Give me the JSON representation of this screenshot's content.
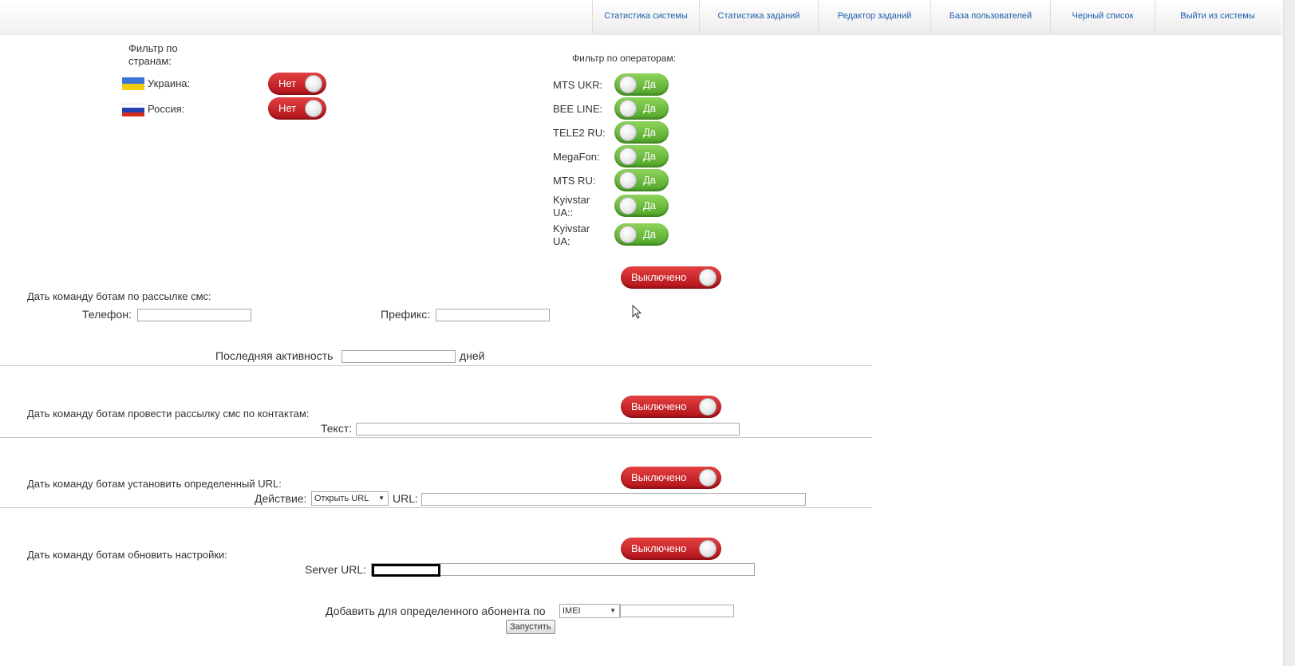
{
  "nav": [
    {
      "label": "Статистика системы"
    },
    {
      "label": "Статистика заданий"
    },
    {
      "label": "Редактор заданий"
    },
    {
      "label": "База пользователей"
    },
    {
      "label": "Черный список"
    },
    {
      "label": "Выйти из системы"
    }
  ],
  "country_filter": {
    "title_line1": "Фильтр по",
    "title_line2": "странам:",
    "items": [
      {
        "label": "Украина:",
        "toggle": "Нет",
        "flag_colors": [
          "#3a74d4",
          "#f3cc12"
        ]
      },
      {
        "label": "Россия:",
        "toggle": "Нет",
        "flag_colors": [
          "#ffffff",
          "#2240b2",
          "#d52b1e"
        ]
      }
    ]
  },
  "operator_filter": {
    "title": "Фильтр по операторам:",
    "items": [
      {
        "label": "MTS UKR:",
        "toggle": "Да"
      },
      {
        "label": "BEE LINE:",
        "toggle": "Да"
      },
      {
        "label": "TELE2 RU:",
        "toggle": "Да"
      },
      {
        "label": "MegaFon:",
        "toggle": "Да"
      },
      {
        "label": "MTS RU:",
        "toggle": "Да"
      },
      {
        "label_line1": "Kyivstar",
        "label_line2": "UA::",
        "toggle": "Да"
      },
      {
        "label_line1": "Kyivstar",
        "label_line2": "UA:",
        "toggle": "Да"
      }
    ]
  },
  "sms_send": {
    "title": "Дать команду ботам по рассылке смс:",
    "toggle": "Выключено",
    "phone_label": "Телефон:",
    "prefix_label": "Префикс:",
    "activity_label": "Последняя активность",
    "activity_unit": "дней"
  },
  "contacts_send": {
    "title": "Дать команду ботам провести рассылку смс по контактам:",
    "toggle": "Выключено",
    "text_label": "Текст:"
  },
  "url_set": {
    "title": "Дать команду ботам установить определенный URL:",
    "toggle": "Выключено",
    "action_label": "Действие:",
    "action_value": "Открыть URL",
    "url_label": "URL:"
  },
  "settings_update": {
    "title": "Дать команду ботам обновить настройки:",
    "toggle": "Выключено",
    "server_label": "Server URL:"
  },
  "add_subscriber": {
    "label": "Добавить для определенного абонента по",
    "select_value": "IMEI",
    "button": "Запустить"
  },
  "colors": {
    "toggle_off": "#c81b22",
    "toggle_on": "#6cbf3a",
    "nav_link": "#1f5fa8"
  }
}
